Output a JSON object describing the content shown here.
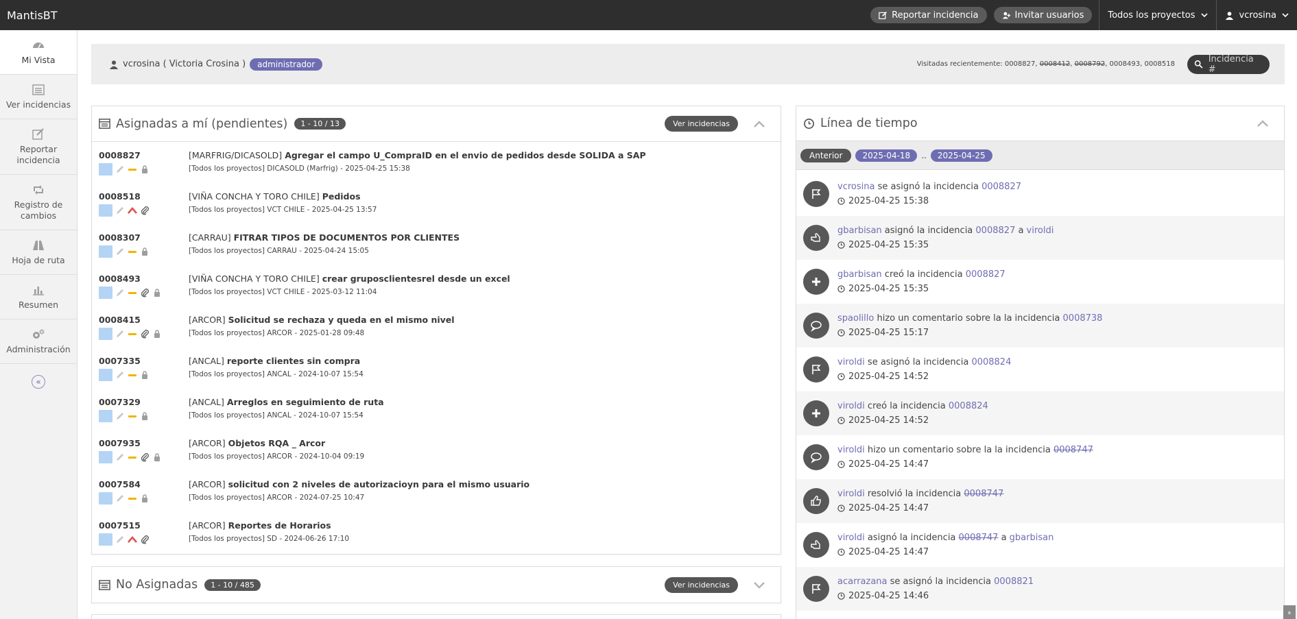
{
  "navbar": {
    "brand": "MantisBT",
    "report_btn": "Reportar incidencia",
    "invite_btn": "Invitar usuarios",
    "project_dd": "Todos los proyectos",
    "user_dd": "vcrosina"
  },
  "sidebar": {
    "items": [
      {
        "label": "Mi Vista",
        "icon": "dashboard-icon"
      },
      {
        "label": "Ver incidencias",
        "icon": "list-icon"
      },
      {
        "label": "Reportar incidencia",
        "icon": "edit-icon"
      },
      {
        "label": "Registro de cambios",
        "icon": "retweet-icon"
      },
      {
        "label": "Hoja de ruta",
        "icon": "road-icon"
      },
      {
        "label": "Resumen",
        "icon": "bar-chart-icon"
      },
      {
        "label": "Administración",
        "icon": "gears-icon"
      }
    ],
    "collapse_glyph": "«"
  },
  "user_strip": {
    "user": "vcrosina ( Victoria Crosina )",
    "role": "administrador",
    "recent_label": "Visitadas recientemente:",
    "recent": [
      {
        "id": "0008827",
        "strike": false
      },
      {
        "id": "0008412",
        "strike": true
      },
      {
        "id": "0008792",
        "strike": true
      },
      {
        "id": "0008493",
        "strike": false
      },
      {
        "id": "0008518",
        "strike": false
      }
    ],
    "search_placeholder": "Incidencia #"
  },
  "assigned": {
    "title": "Asignadas a mí (pendientes)",
    "count": "1 - 10 / 13",
    "view_btn": "Ver incidencias",
    "issues": [
      {
        "id": "0008827",
        "project": "[MARFRIG/DICASOLD]",
        "summary": "Agregar el campo U_CompraID en el envio de pedidos desde SOLIDA a SAP",
        "meta": "[Todos los proyectos] DICASOLD (Marfrig) - 2025-04-25 15:38",
        "priority": "normal",
        "attach": false,
        "lock": true
      },
      {
        "id": "0008518",
        "project": "[VIÑA CONCHA Y TORO CHILE]",
        "summary": "Pedidos",
        "meta": "[Todos los proyectos] VCT CHILE - 2025-04-25 13:57",
        "priority": "high",
        "attach": true,
        "lock": false
      },
      {
        "id": "0008307",
        "project": "[CARRAU]",
        "summary": "FITRAR TIPOS DE DOCUMENTOS POR CLIENTES",
        "meta": "[Todos los proyectos] CARRAU - 2025-04-24 15:05",
        "priority": "normal",
        "attach": false,
        "lock": true
      },
      {
        "id": "0008493",
        "project": "[VIÑA CONCHA Y TORO CHILE]",
        "summary": "crear gruposclientesrel desde un excel",
        "meta": "[Todos los proyectos] VCT CHILE - 2025-03-12 11:04",
        "priority": "normal",
        "attach": true,
        "lock": true
      },
      {
        "id": "0008415",
        "project": "[ARCOR]",
        "summary": "Solicitud se rechaza y queda en el mismo nivel",
        "meta": "[Todos los proyectos] ARCOR - 2025-01-28 09:48",
        "priority": "normal",
        "attach": true,
        "lock": true
      },
      {
        "id": "0007335",
        "project": "[ANCAL]",
        "summary": "reporte clientes sin compra",
        "meta": "[Todos los proyectos] ANCAL - 2024-10-07 15:54",
        "priority": "normal",
        "attach": false,
        "lock": true
      },
      {
        "id": "0007329",
        "project": "[ANCAL]",
        "summary": "Arreglos en seguimiento de ruta",
        "meta": "[Todos los proyectos] ANCAL - 2024-10-07 15:54",
        "priority": "normal",
        "attach": false,
        "lock": true
      },
      {
        "id": "0007935",
        "project": "[ARCOR]",
        "summary": "Objetos RQA _ Arcor",
        "meta": "[Todos los proyectos] ARCOR - 2024-10-04 09:19",
        "priority": "normal",
        "attach": true,
        "lock": true
      },
      {
        "id": "0007584",
        "project": "[ARCOR]",
        "summary": "solicitud con 2 niveles de autorizacioyn para el mismo usuario",
        "meta": "[Todos los proyectos] ARCOR - 2024-07-25 10:47",
        "priority": "normal",
        "attach": false,
        "lock": true
      },
      {
        "id": "0007515",
        "project": "[ARCOR]",
        "summary": "Reportes de Horarios",
        "meta": "[Todos los proyectos] SD - 2024-06-26 17:10",
        "priority": "high",
        "attach": true,
        "lock": false
      }
    ]
  },
  "unassigned": {
    "title": "No Asignadas",
    "count": "1 - 10 / 485",
    "view_btn": "Ver incidencias"
  },
  "timeline": {
    "title": "Línea de tiempo",
    "prev_btn": "Anterior",
    "date_from": "2025-04-18",
    "sep": "..",
    "date_to": "2025-04-25",
    "entries": [
      {
        "icon": "flag-icon",
        "parts": [
          {
            "t": "vcrosina",
            "link": true
          },
          {
            "t": " se asignó la incidencia "
          },
          {
            "t": "0008827",
            "link": true
          }
        ],
        "time": "2025-04-25 15:38"
      },
      {
        "icon": "hand-point-icon",
        "parts": [
          {
            "t": "gbarbisan",
            "link": true
          },
          {
            "t": " asignó la incidencia "
          },
          {
            "t": "0008827",
            "link": true
          },
          {
            "t": " a "
          },
          {
            "t": "viroldi",
            "link": true
          }
        ],
        "time": "2025-04-25 15:35"
      },
      {
        "icon": "plus-icon",
        "parts": [
          {
            "t": "gbarbisan",
            "link": true
          },
          {
            "t": " creó la incidencia "
          },
          {
            "t": "0008827",
            "link": true
          }
        ],
        "time": "2025-04-25 15:35"
      },
      {
        "icon": "comment-icon",
        "parts": [
          {
            "t": "spaolillo",
            "link": true
          },
          {
            "t": " hizo un comentario sobre la la incidencia "
          },
          {
            "t": "0008738",
            "link": true
          }
        ],
        "time": "2025-04-25 15:17"
      },
      {
        "icon": "flag-icon",
        "parts": [
          {
            "t": "viroldi",
            "link": true
          },
          {
            "t": " se asignó la incidencia "
          },
          {
            "t": "0008824",
            "link": true
          }
        ],
        "time": "2025-04-25 14:52"
      },
      {
        "icon": "plus-icon",
        "parts": [
          {
            "t": "viroldi",
            "link": true
          },
          {
            "t": " creó la incidencia "
          },
          {
            "t": "0008824",
            "link": true
          }
        ],
        "time": "2025-04-25 14:52"
      },
      {
        "icon": "comment-icon",
        "parts": [
          {
            "t": "viroldi",
            "link": true
          },
          {
            "t": " hizo un comentario sobre la la incidencia "
          },
          {
            "t": "0008747",
            "link": true,
            "strike": true
          }
        ],
        "time": "2025-04-25 14:47"
      },
      {
        "icon": "thumbs-up-icon",
        "parts": [
          {
            "t": "viroldi",
            "link": true
          },
          {
            "t": " resolvió la incidencia "
          },
          {
            "t": "0008747",
            "link": true,
            "strike": true
          }
        ],
        "time": "2025-04-25 14:47"
      },
      {
        "icon": "hand-point-icon",
        "parts": [
          {
            "t": "viroldi",
            "link": true
          },
          {
            "t": " asignó la incidencia "
          },
          {
            "t": "0008747",
            "link": true,
            "strike": true
          },
          {
            "t": " a "
          },
          {
            "t": "gbarbisan",
            "link": true
          }
        ],
        "time": "2025-04-25 14:47"
      },
      {
        "icon": "flag-icon",
        "parts": [
          {
            "t": "acarrazana",
            "link": true
          },
          {
            "t": " se asignó la incidencia "
          },
          {
            "t": "0008821",
            "link": true
          }
        ],
        "time": "2025-04-25 14:46"
      }
    ]
  },
  "scroll_top": "«",
  "colors": {
    "navbar": "#2e2e2e",
    "accent": "#6f6db2",
    "status_assigned": "#b3d4f5",
    "priority_normal": "#f0b400",
    "priority_high": "#d9534f"
  }
}
